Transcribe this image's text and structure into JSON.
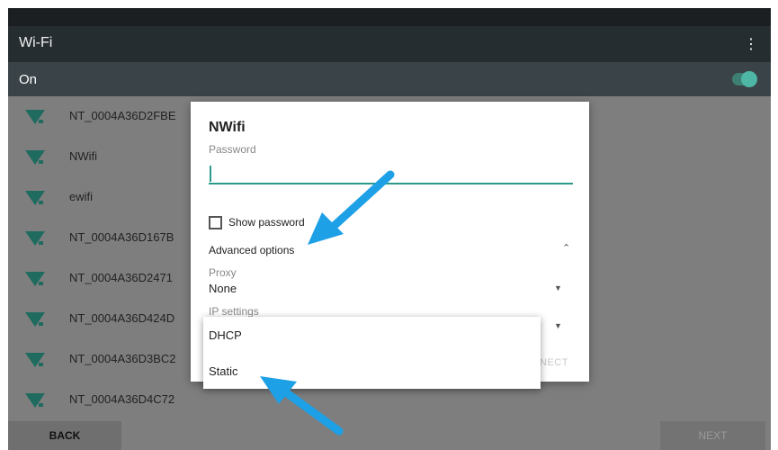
{
  "appbar": {
    "title": "Wi-Fi",
    "menu_icon": "overflow-menu-icon"
  },
  "onbar": {
    "label": "On",
    "toggle_on": true
  },
  "networks": [
    {
      "ssid": "NT_0004A36D2FBE"
    },
    {
      "ssid": "NWifi"
    },
    {
      "ssid": "ewifi"
    },
    {
      "ssid": "NT_0004A36D167B"
    },
    {
      "ssid": "NT_0004A36D2471"
    },
    {
      "ssid": "NT_0004A36D424D"
    },
    {
      "ssid": "NT_0004A36D3BC2"
    },
    {
      "ssid": "NT_0004A36D4C72"
    }
  ],
  "footer": {
    "back_label": "BACK",
    "next_label": "NEXT"
  },
  "dialog": {
    "title": "NWifi",
    "password_label": "Password",
    "password_value": "",
    "show_password_label": "Show password",
    "show_password_checked": false,
    "advanced_label": "Advanced options",
    "proxy_label": "Proxy",
    "proxy_value": "None",
    "ip_label": "IP settings",
    "connect_label": "NECT"
  },
  "ip_dropdown": {
    "options": [
      "DHCP",
      "Static"
    ]
  },
  "colors": {
    "accent": "#2b9a8a",
    "toggle": "#4db6a4",
    "arrow": "#1ea0e6",
    "wifi_icon": "#1f6b5f"
  }
}
